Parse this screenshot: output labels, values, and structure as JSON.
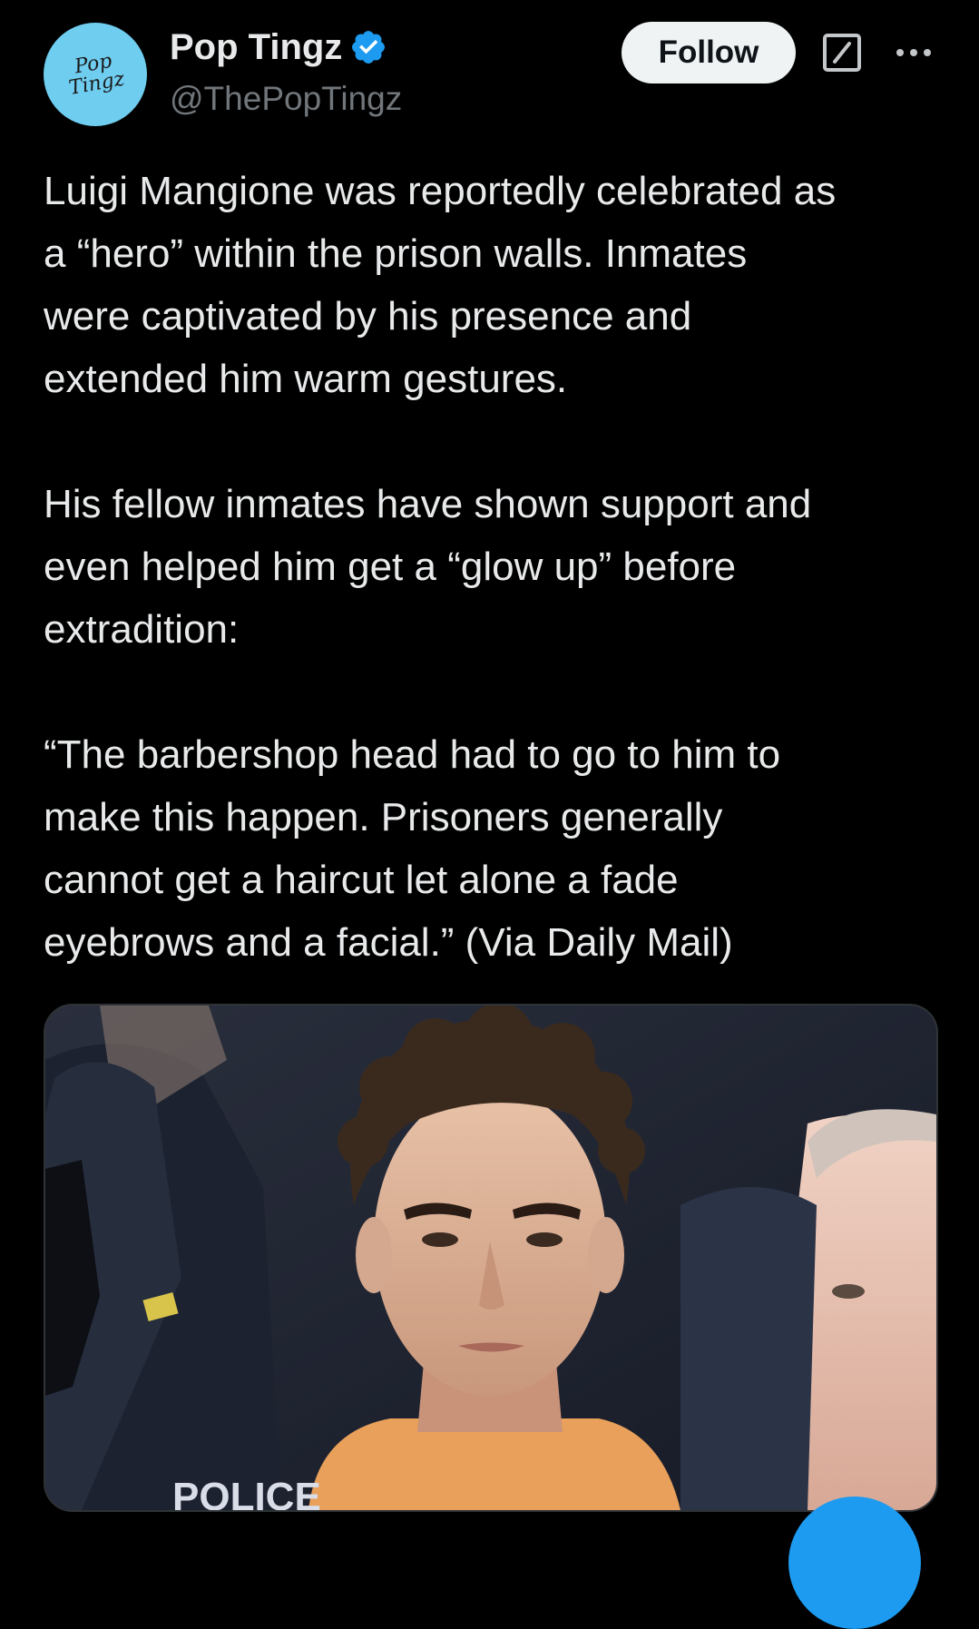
{
  "author": {
    "display_name": "Pop Tingz",
    "handle": "@ThePopTingz",
    "avatar_text": "Pop\nTingz",
    "verified_color": "#1d9bf0"
  },
  "actions": {
    "follow_label": "Follow",
    "grok_icon": "grok-slash-icon",
    "more_icon": "more-dots-icon"
  },
  "tweet": {
    "paragraphs": [
      "Luigi Mangione was reportedly celebrated as\na “hero” within the prison walls. Inmates\nwere captivated by his presence and\nextended him warm gestures.",
      "His fellow inmates have shown support and\neven helped him get a “glow up” before\nextradition:",
      "“The barbershop head had to go to him to\nmake this happen. Prisoners generally\ncannot get a haircut let alone a fade\neyebrows and a facial.” (Via Daily Mail)"
    ]
  },
  "media": {
    "partial_text": "POLICE"
  },
  "colors": {
    "background": "#000000",
    "text": "#e7e9ea",
    "secondary": "#71767b",
    "accent": "#1d9bf0"
  }
}
